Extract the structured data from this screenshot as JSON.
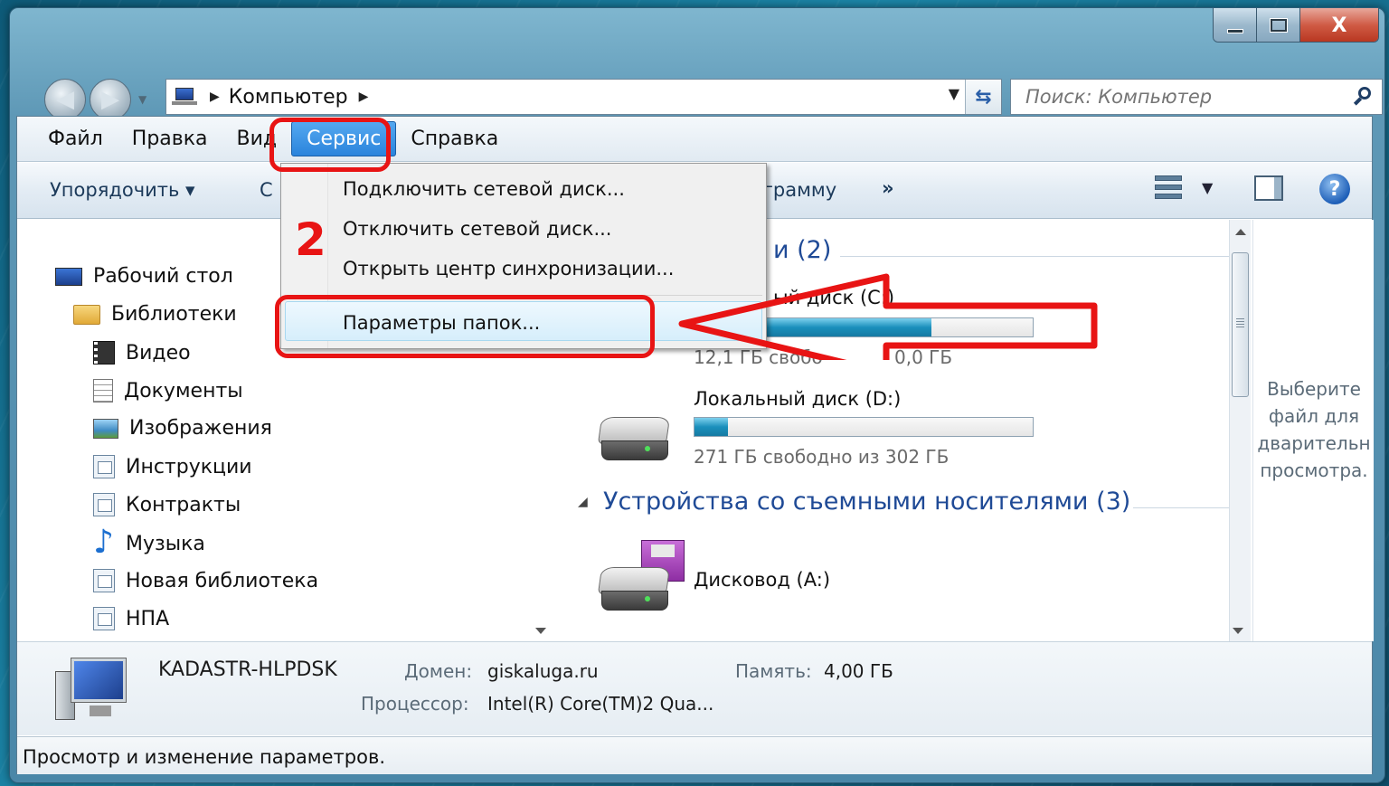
{
  "address_bar": {
    "location": "Компьютер"
  },
  "search": {
    "placeholder": "Поиск: Компьютер"
  },
  "menubar": {
    "items": [
      "Файл",
      "Правка",
      "Вид",
      "Сервис",
      "Справка"
    ],
    "active": "Сервис"
  },
  "toolbar": {
    "organize": "Упорядочить ▾",
    "partial_left": "С",
    "partial_right": "ограмму",
    "more": "»"
  },
  "nav_tree": [
    {
      "label": "Рабочий стол",
      "icon": "desktop-icon"
    },
    {
      "label": "Библиотеки",
      "icon": "folder-icon"
    },
    {
      "label": "Видео",
      "icon": "video-icon"
    },
    {
      "label": "Документы",
      "icon": "document-icon"
    },
    {
      "label": "Изображения",
      "icon": "image-icon"
    },
    {
      "label": "Инструкции",
      "icon": "library-icon"
    },
    {
      "label": "Контракты",
      "icon": "library-icon"
    },
    {
      "label": "Музыка",
      "icon": "music-icon"
    },
    {
      "label": "Новая библиотека",
      "icon": "library-icon"
    },
    {
      "label": "НПА",
      "icon": "library-icon"
    }
  ],
  "content": {
    "group_hdd_partial": "и (2)",
    "drive_c_partial": "ый диск (C:)",
    "drive_c_free_partial": "12,1 ГБ свобо",
    "drive_c_total_partial": "0,0 ГБ",
    "drive_c_fill": 0.7,
    "drive_d_name": "Локальный диск (D:)",
    "drive_d_free": "271 ГБ свободно из 302 ГБ",
    "drive_d_fill": 0.1,
    "group_removable": "Устройства со съемными носителями (3)",
    "floppy_name": "Дисковод (A:)"
  },
  "preview": {
    "text": "Выберите\nфайл для\nдварительн\nпросмотра."
  },
  "details": {
    "computer_name": "KADASTR-HLPDSK",
    "domain_label": "Домен:",
    "domain_value": "giskaluga.ru",
    "memory_label": "Память:",
    "memory_value": "4,00 ГБ",
    "cpu_label": "Процессор:",
    "cpu_value": "Intel(R) Core(TM)2 Qua..."
  },
  "status": {
    "text": "Просмотр и изменение параметров."
  },
  "dropdown": {
    "items": [
      "Подключить сетевой диск...",
      "Отключить сетевой диск...",
      "Открыть центр синхронизации...",
      "Параметры папок..."
    ],
    "highlighted": "Параметры папок..."
  },
  "annotation": {
    "step_number": "2",
    "color": "#e81414"
  },
  "window_controls": {
    "close": "X"
  }
}
